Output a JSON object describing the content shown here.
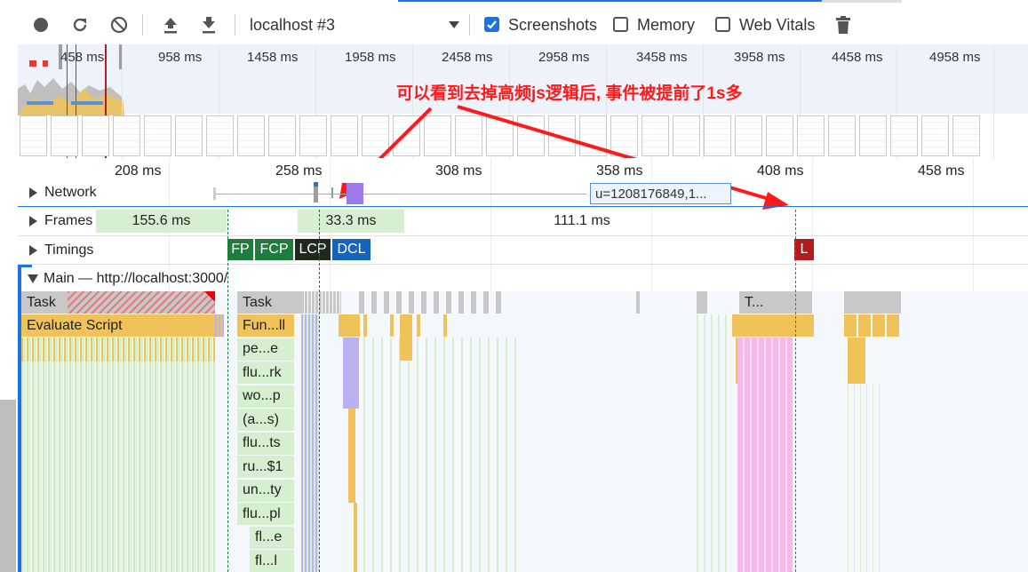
{
  "toolbar": {
    "record_icon": "record-icon",
    "reload_icon": "reload-icon",
    "clear_icon": "clear-icon",
    "upload_icon": "upload-icon",
    "download_icon": "download-icon",
    "profile_select": "localhost #3",
    "screenshots_label": "Screenshots",
    "screenshots_checked": true,
    "memory_label": "Memory",
    "memory_checked": false,
    "webvitals_label": "Web Vitals",
    "webvitals_checked": false,
    "trash_icon": "trash-icon"
  },
  "overview": {
    "time_labels": [
      "458 ms",
      "958 ms",
      "1458 ms",
      "1958 ms",
      "2458 ms",
      "2958 ms",
      "3458 ms",
      "3958 ms",
      "4458 ms",
      "4958 ms"
    ]
  },
  "annotation": {
    "text": "可以看到去掉高频js逻辑后, 事件被提前了1s多",
    "color": "#ff1a1a"
  },
  "ruler": {
    "labels": [
      "208 ms",
      "258 ms",
      "308 ms",
      "358 ms",
      "408 ms",
      "458 ms"
    ]
  },
  "tracks": {
    "network_label": "Network",
    "network_request": "u=1208176849,1...",
    "frames_label": "Frames",
    "frames": [
      "155.6 ms",
      "33.3 ms",
      "111.1 ms"
    ],
    "timings_label": "Timings",
    "timings": [
      "FP",
      "FCP",
      "LCP",
      "DCL",
      "L"
    ],
    "main_label": "Main — http://localhost:3000/"
  },
  "flame": {
    "task_left": "Task",
    "task_mid": "Task",
    "task_right": "T...",
    "evaluate_script": "Evaluate Script",
    "stack": [
      "Fun...ll",
      "pe...e",
      "flu...rk",
      "wo...p",
      "(a...s)",
      "flu...ts",
      "ru...$1",
      "un...ty",
      "flu...pl",
      "fl...e",
      "fl...l"
    ]
  },
  "colors": {
    "task": "#c8c8c8",
    "script": "#f0c35a",
    "green": "#d5efd0",
    "purple": "#b9b1f0",
    "pink": "#f5b8e8",
    "fp": "#1e7d3c",
    "lcp": "#1d2a1d",
    "dcl": "#1565c0",
    "load": "#b21c1c"
  }
}
